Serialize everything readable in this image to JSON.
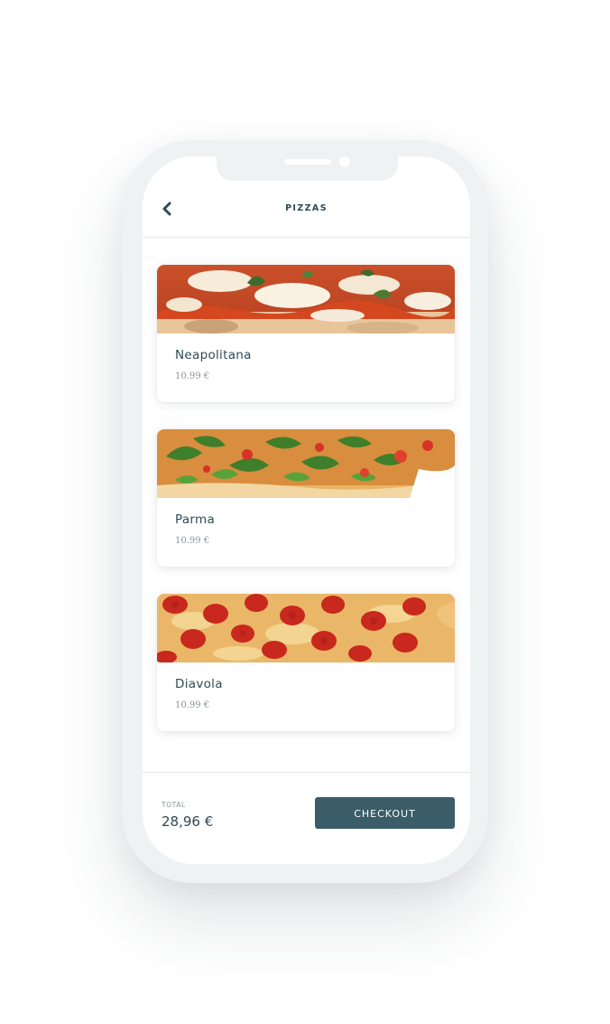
{
  "header": {
    "title": "PIZZAS",
    "back_icon": "chevron-left-icon"
  },
  "products": [
    {
      "name": "Neapolitana",
      "price": "10.99 €",
      "image": "margherita-pizza-photo"
    },
    {
      "name": "Parma",
      "price": "10.99 €",
      "image": "arugula-pizza-photo"
    },
    {
      "name": "Diavola",
      "price": "10.99 €",
      "image": "pepperoni-pizza-photo"
    }
  ],
  "footer": {
    "total_label": "TOTAL",
    "total_value": "28,96 €",
    "checkout_label": "CHECKOUT"
  },
  "colors": {
    "accent": "#3a5d68",
    "text": "#2f4a56",
    "muted": "#8a959b",
    "frame": "#eef2f3"
  }
}
